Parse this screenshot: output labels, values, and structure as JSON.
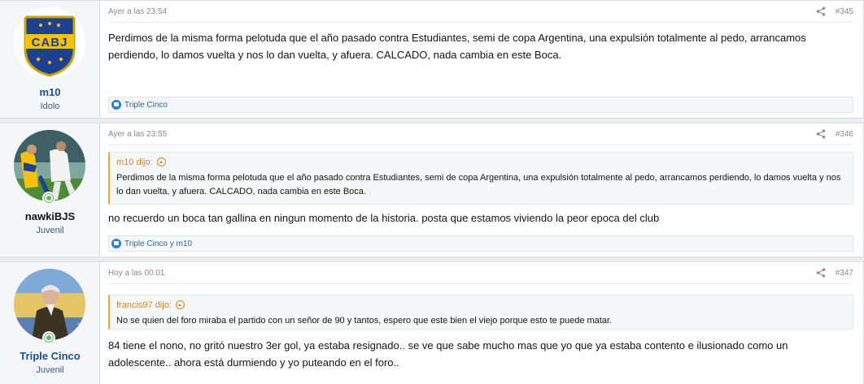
{
  "posts": [
    {
      "author": "m10",
      "user_title": "Idolo",
      "avatar_text": "CABJ",
      "date": "Ayer a las 23:54",
      "post_number": "#345",
      "body": "Perdimos de la misma forma pelotuda que el año pasado contra Estudiantes, semi de copa Argentina, una expulsión totalmente al pedo, arrancamos perdiendo, lo damos vuelta y nos lo dan vuelta, y afuera. CALCADO, nada cambia en este Boca.",
      "reactions": "Triple Cinco"
    },
    {
      "author": "nawkiBJS",
      "user_title": "Juvenil",
      "date": "Ayer a las 23:55",
      "post_number": "#346",
      "quote_author": "m10 dijo:",
      "quote_body": "Perdimos de la misma forma pelotuda que el año pasado contra Estudiantes, semi de copa Argentina, una expulsión totalmente al pedo, arrancamos perdiendo, lo damos vuelta y nos lo dan vuelta, y afuera. CALCADO, nada cambia en este Boca.",
      "body": "no recuerdo un boca tan gallina en ningun momento de la historia. posta que estamos viviendo la peor epoca del club",
      "reactions": "Triple Cinco y m10"
    },
    {
      "author": "Triple Cinco",
      "user_title": "Juvenil",
      "date": "Hoy a las 00:01",
      "post_number": "#347",
      "quote_author": "francis97 dijo:",
      "quote_body": "No se quien del foro miraba el partido con un señor de 90 y tantos, espero que este bien el viejo porque esto te puede matar.",
      "body": "84 tiene el nono, no gritó nuestro 3er gol, ya estaba resignado.. se ve que sabe mucho mas que yo que ya estaba contento e ilusionado como un adolescente.. ahora está durmiendo y yo puteando en el foro.."
    }
  ],
  "colors": {
    "boca_blue": "#1f3f8f",
    "boca_yellow": "#f4c20d",
    "quote_accent": "#f1a04a",
    "link_blue": "#2a66a8",
    "online_green": "#63b265"
  },
  "icons": {
    "share": "share-icon",
    "quote_jump": "arrow-up-circle-icon",
    "like": "like-icon",
    "online": "online-status-icon"
  }
}
